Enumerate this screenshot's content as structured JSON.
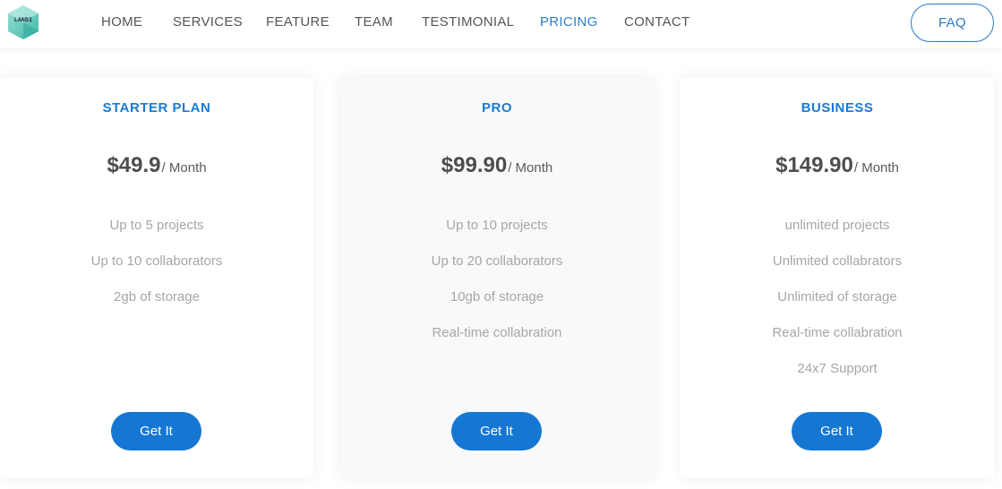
{
  "brand": {
    "logo_text": "LANDI"
  },
  "nav": {
    "items": [
      {
        "label": "HOME"
      },
      {
        "label": "SERVICES"
      },
      {
        "label": "FEATURE"
      },
      {
        "label": "TEAM"
      },
      {
        "label": "TESTIMONIAL"
      },
      {
        "label": "PRICING"
      },
      {
        "label": "CONTACT"
      }
    ],
    "active": "PRICING",
    "faq_label": "FAQ"
  },
  "colors": {
    "accent": "#1677d2",
    "active_nav": "#2d7ec9",
    "plan_title": "#1a7ad4",
    "feature_text": "#a6a6a6"
  },
  "plans": [
    {
      "name": "STARTER PLAN",
      "price": "$49.9",
      "period": "/ Month",
      "features": [
        "Up to 5 projects",
        "Up to 10 collaborators",
        "2gb of storage"
      ],
      "button": "Get It"
    },
    {
      "name": "PRO",
      "price": "$99.90",
      "period": "/ Month",
      "features": [
        "Up to 10 projects",
        "Up to 20 collaborators",
        "10gb of storage",
        "Real-time collabration"
      ],
      "button": "Get It"
    },
    {
      "name": "BUSINESS",
      "price": "$149.90",
      "period": "/ Month",
      "features": [
        "unlimited projects",
        "Unlimited collabrators",
        "Unlimited of storage",
        "Real-time collabration",
        "24x7 Support"
      ],
      "button": "Get It"
    }
  ]
}
